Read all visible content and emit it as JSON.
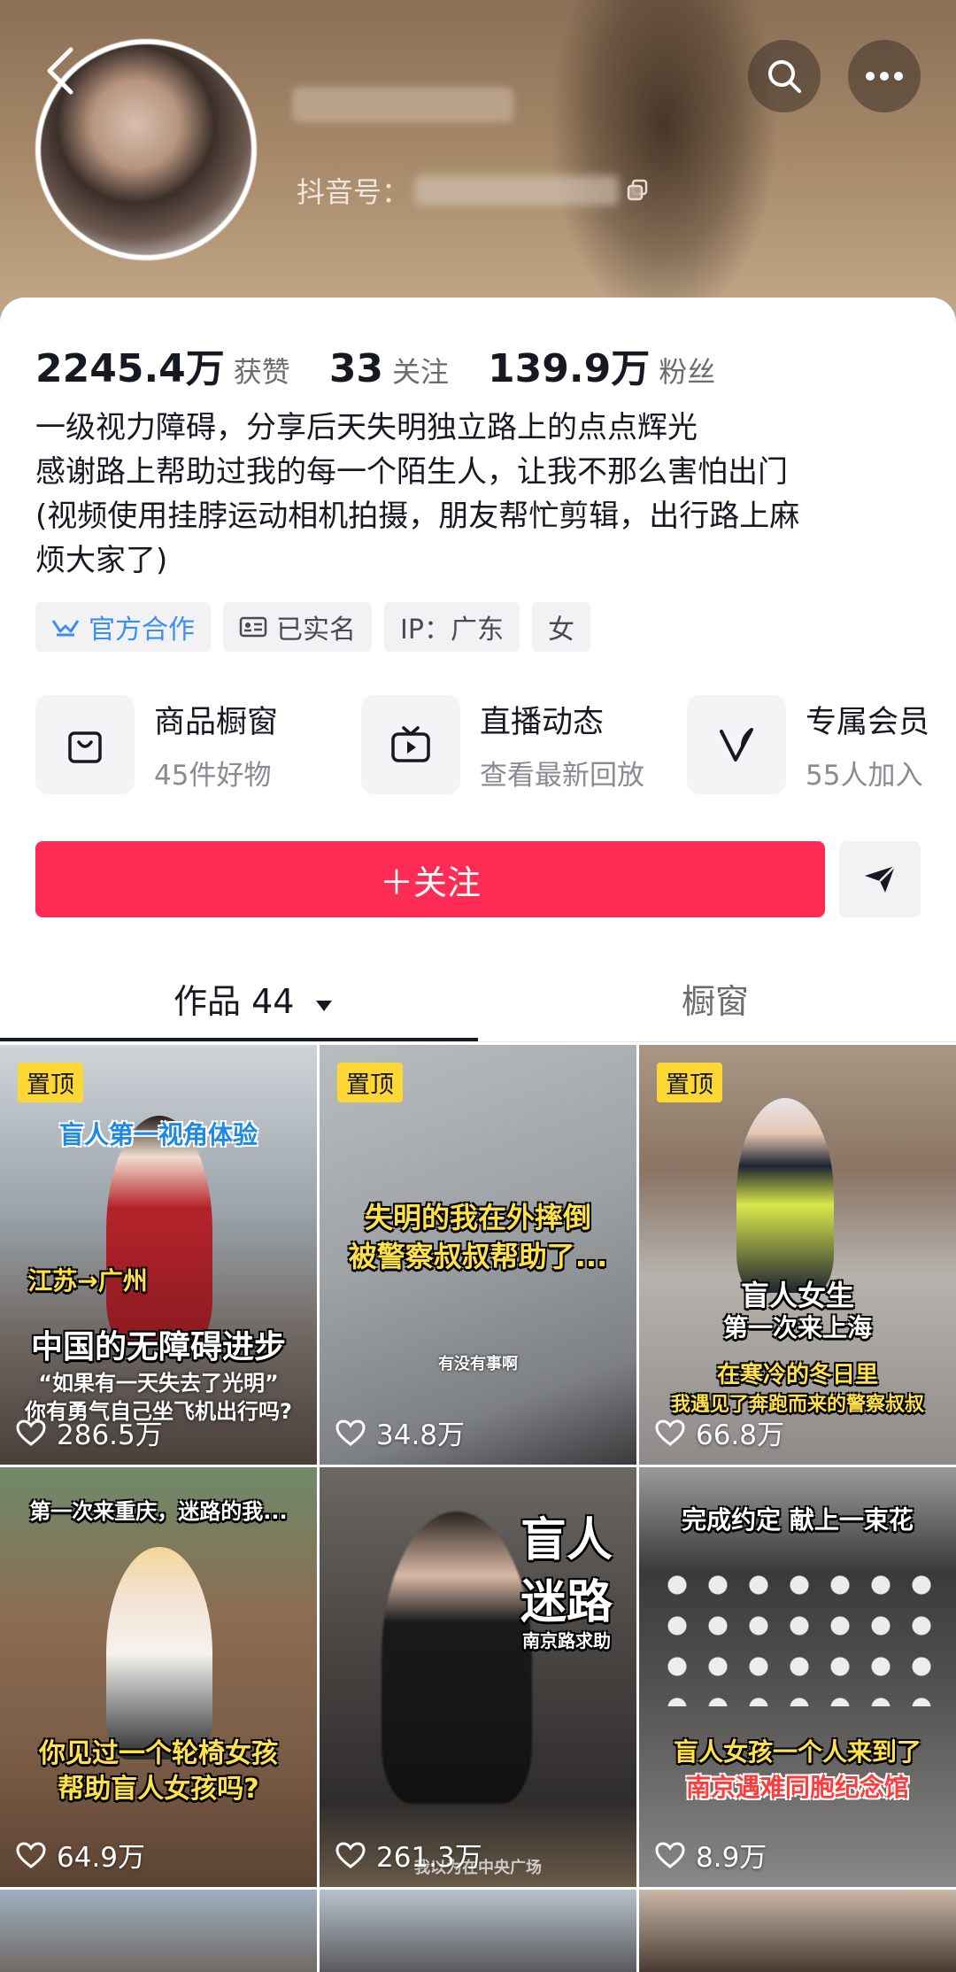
{
  "header": {
    "id_label": "抖音号：",
    "back_icon": "chevron-left-icon",
    "search_icon": "search-icon",
    "more_icon": "more-icon"
  },
  "stats": [
    {
      "value": "2245.4万",
      "label": "获赞"
    },
    {
      "value": "33",
      "label": "关注"
    },
    {
      "value": "139.9万",
      "label": "粉丝"
    }
  ],
  "bio": [
    "一级视力障碍，分享后天失明独立路上的点点辉光",
    "感谢路上帮助过我的每一个陌生人，让我不那么害怕出门",
    "(视频使用挂脖运动相机拍摄，朋友帮忙剪辑，出行路上麻",
    "烦大家了)"
  ],
  "tags": {
    "official": "官方合作",
    "verified": "已实名",
    "ip": "IP：广东",
    "gender": "女"
  },
  "features": [
    {
      "title": "商品橱窗",
      "subtitle": "45件好物",
      "icon": "shopping-bag-icon"
    },
    {
      "title": "直播动态",
      "subtitle": "查看最新回放",
      "icon": "tv-icon"
    },
    {
      "title": "专属会员",
      "subtitle": "55人加入",
      "icon": "membership-v-icon"
    }
  ],
  "actions": {
    "follow": "＋关注",
    "share_icon": "send-icon"
  },
  "tabs": {
    "works": "作品 44",
    "window": "橱窗"
  },
  "videos": [
    {
      "pinned": "置顶",
      "likes": "286.5万",
      "captions": [
        "盲人第一视角体验",
        "江苏→广州",
        "中国的无障碍进步",
        "“如果有一天失去了光明”",
        "你有勇气自己坐飞机出行吗?"
      ]
    },
    {
      "pinned": "置顶",
      "likes": "34.8万",
      "captions": [
        "失明的我在外摔倒",
        "被警察叔叔帮助了...",
        "有没有事啊"
      ]
    },
    {
      "pinned": "置顶",
      "likes": "66.8万",
      "captions": [
        "盲人女生",
        "第一次来上海",
        "在寒冷的冬日里",
        "我遇见了奔跑而来的警察叔叔"
      ]
    },
    {
      "likes": "64.9万",
      "captions": [
        "第一次来重庆，迷路的我...",
        "你见过一个轮椅女孩",
        "帮助盲人女孩吗?"
      ]
    },
    {
      "likes": "261.3万",
      "captions": [
        "盲人",
        "迷路",
        "南京路求助",
        "我以为在中央广场"
      ]
    },
    {
      "likes": "8.9万",
      "captions": [
        "完成约定 献上一束花",
        "盲人女孩一个人来到了",
        "南京遇难同胞纪念馆"
      ]
    }
  ],
  "colors": {
    "accent": "#fe2c55",
    "pin": "#fdd835",
    "official": "#3b8ff3"
  }
}
